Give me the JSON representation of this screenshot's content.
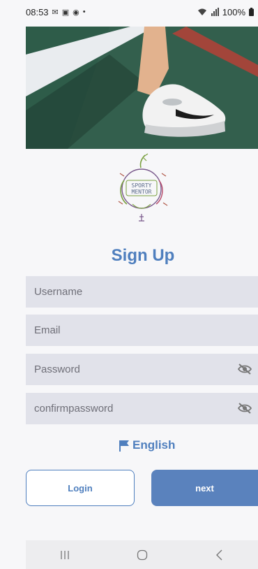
{
  "status_bar": {
    "time": "08:53",
    "battery": "100%"
  },
  "signup": {
    "title": "Sign Up",
    "username_placeholder": "Username",
    "email_placeholder": "Email",
    "password_placeholder": "Password",
    "confirm_placeholder": "confirmpassword"
  },
  "language": {
    "label": "English"
  },
  "buttons": {
    "login": "Login",
    "next": "next"
  },
  "colors": {
    "accent": "#4f7fbe",
    "field_bg": "#e1e2ea",
    "next_bg": "#5a82bd"
  }
}
